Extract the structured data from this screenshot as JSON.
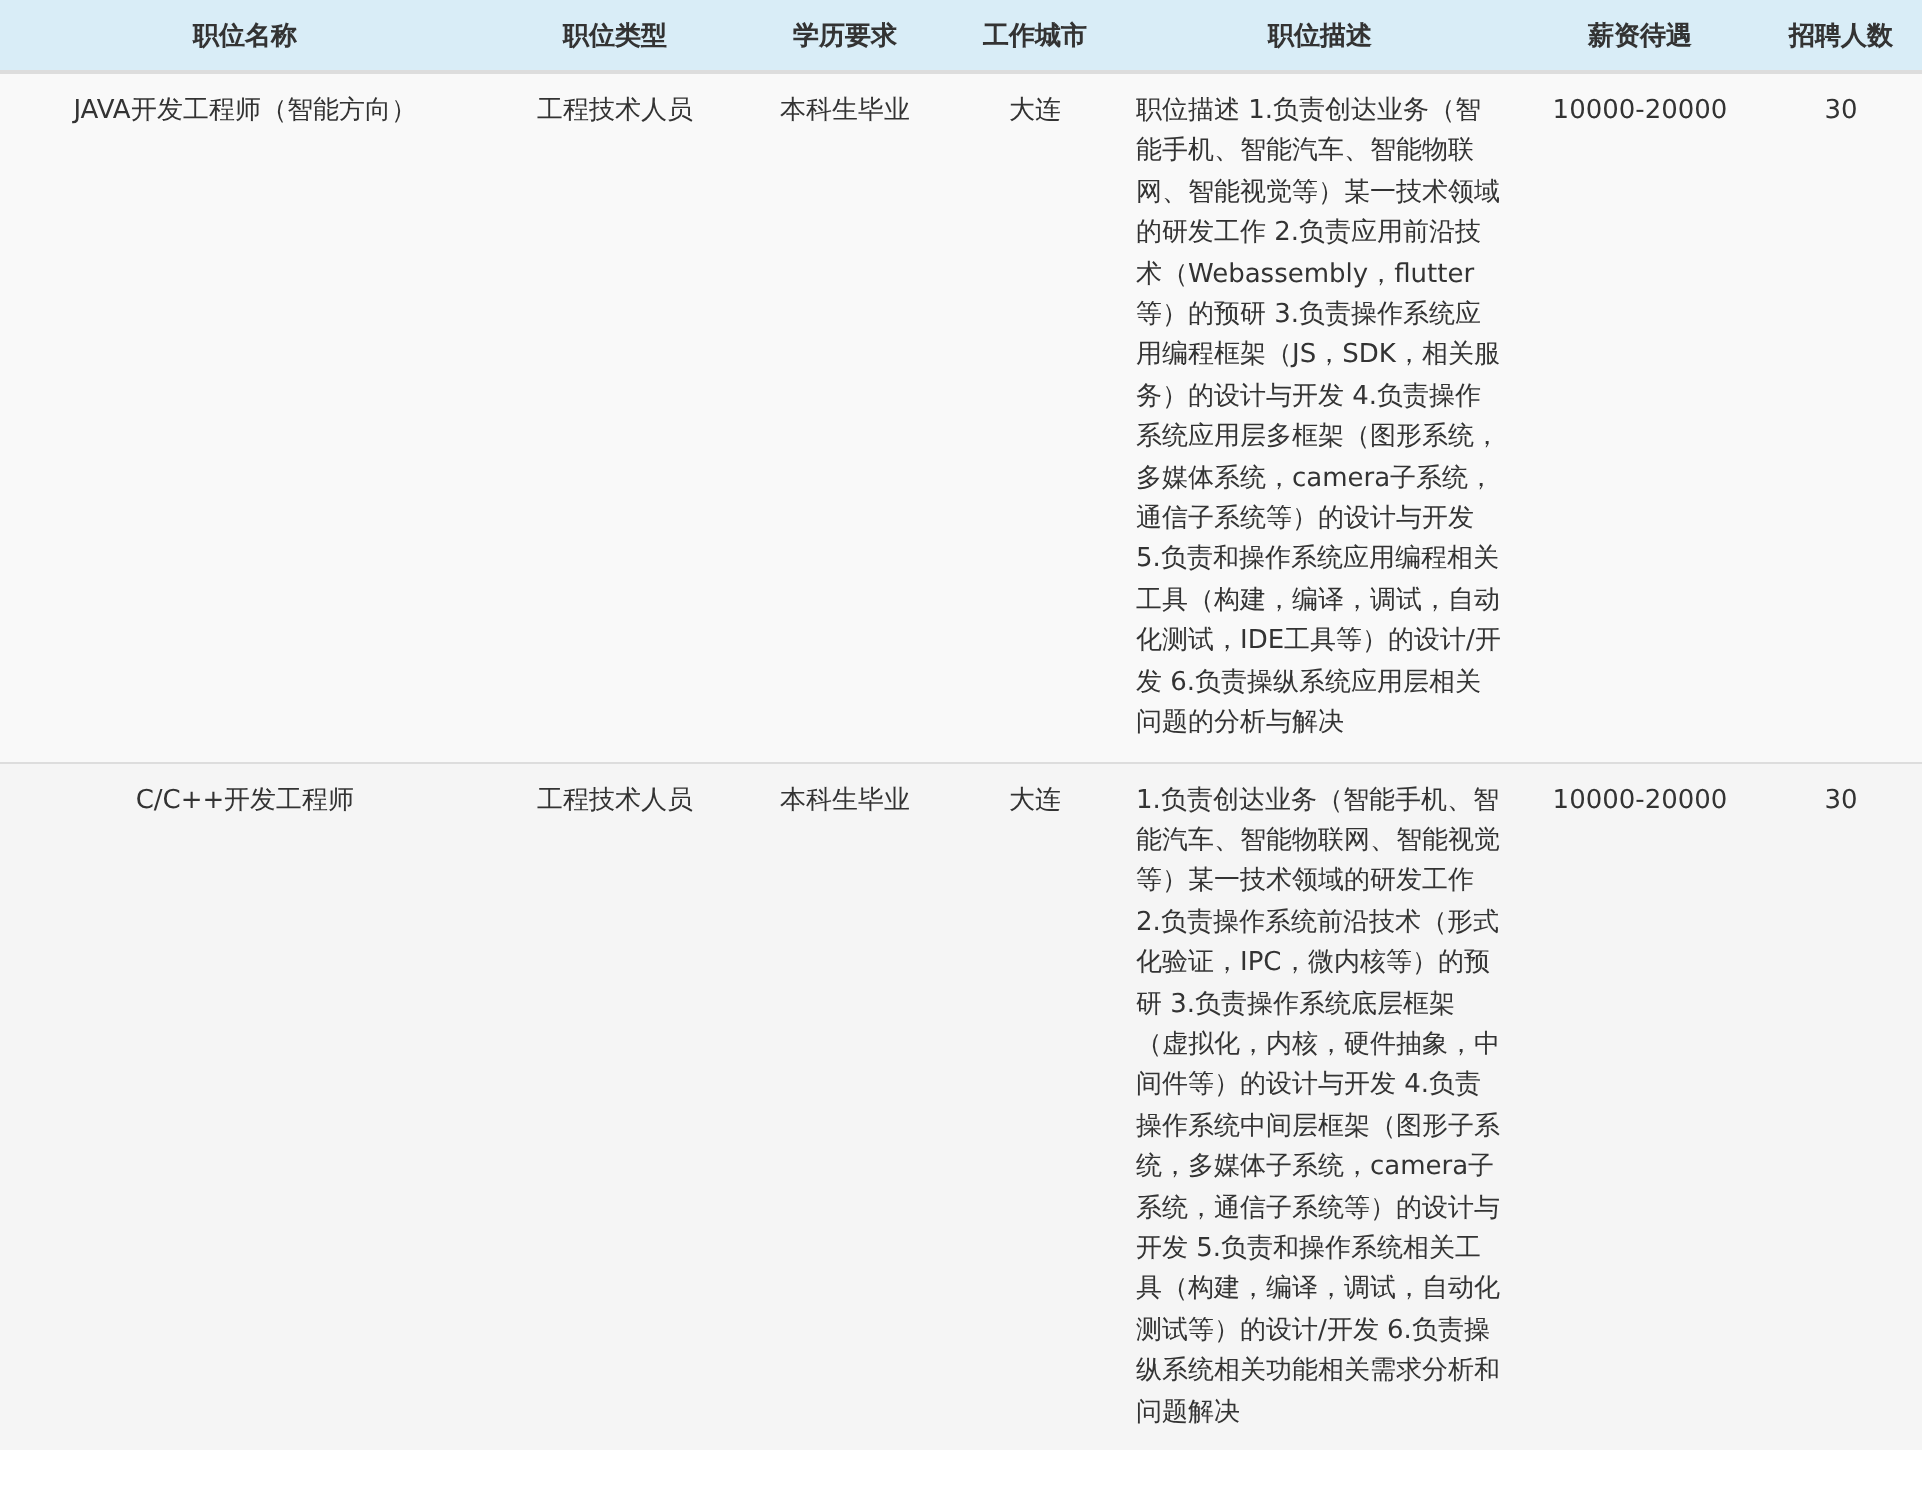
{
  "table": {
    "columns": [
      "职位名称",
      "职位类型",
      "学历要求",
      "工作城市",
      "职位描述",
      "薪资待遇",
      "招聘人数"
    ],
    "rows": [
      {
        "cells": [
          "JAVA开发工程师（智能方向）",
          "工程技术人员",
          "本科生毕业",
          "大连",
          "职位描述 1.负责创达业务（智能手机、智能汽车、智能物联网、智能视觉等）某一技术领域的研发工作 2.负责应用前沿技术（Webassembly，flutter等）的预研 3.负责操作系统应用编程框架（JS，SDK，相关服务）的设计与开发 4.负责操作系统应用层多框架（图形系统，多媒体系统，camera子系统，通信子系统等）的设计与开发 5.负责和操作系统应用编程相关工具（构建，编译，调试，自动化测试，IDE工具等）的设计/开发 6.负责操纵系统应用层相关问题的分析与解决",
          "10000-20000",
          "30"
        ]
      },
      {
        "cells": [
          "C/C++开发工程师",
          "工程技术人员",
          "本科生毕业",
          "大连",
          "1.负责创达业务（智能手机、智能汽车、智能物联网、智能视觉等）某一技术领域的研发工作 2.负责操作系统前沿技术（形式化验证，IPC，微内核等）的预研 3.负责操作系统底层框架（虚拟化，内核，硬件抽象，中间件等）的设计与开发 4.负责操作系统中间层框架（图形子系统，多媒体子系统，camera子系统，通信子系统等）的设计与开发 5.负责和操作系统相关工具（构建，编译，调试，自动化测试等）的设计/开发 6.负责操纵系统相关功能相关需求分析和问题解决",
          "10000-20000",
          "30"
        ]
      }
    ]
  }
}
